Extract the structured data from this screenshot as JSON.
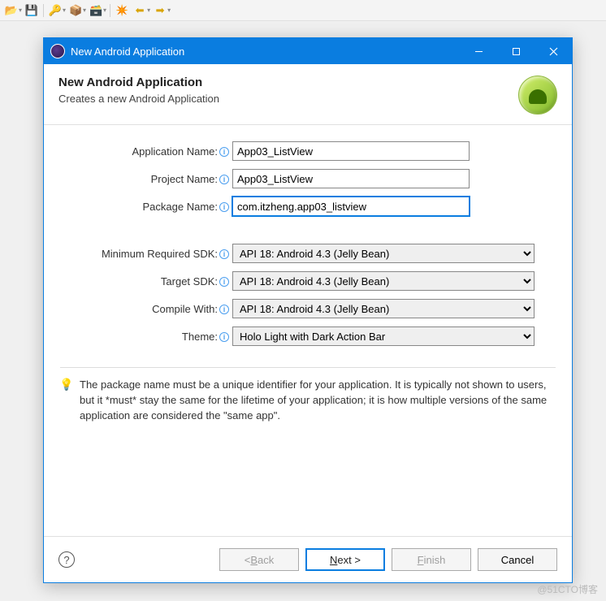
{
  "window": {
    "title": "New Android Application"
  },
  "header": {
    "title": "New Android Application",
    "subtitle": "Creates a new Android Application"
  },
  "fields": {
    "appName": {
      "label": "Application Name:",
      "value": "App03_ListView"
    },
    "projName": {
      "label": "Project Name:",
      "value": "App03_ListView"
    },
    "pkgName": {
      "label": "Package Name:",
      "value": "com.itzheng.app03_listview"
    },
    "minSdk": {
      "label": "Minimum Required SDK:",
      "value": "API 18: Android 4.3 (Jelly Bean)"
    },
    "targetSdk": {
      "label": "Target SDK:",
      "value": "API 18: Android 4.3 (Jelly Bean)"
    },
    "compile": {
      "label": "Compile With:",
      "value": "API 18: Android 4.3 (Jelly Bean)"
    },
    "theme": {
      "label": "Theme:",
      "value": "Holo Light with Dark Action Bar"
    }
  },
  "hint": "The package name must be a unique identifier for your application.\nIt is typically not shown to users, but it *must* stay the same for the lifetime of your application; it is how multiple versions of the same application are considered the \"same app\".",
  "buttons": {
    "back": "< Back",
    "next": "Next >",
    "finish": "Finish",
    "cancel": "Cancel"
  },
  "watermark": "@51CTO博客"
}
